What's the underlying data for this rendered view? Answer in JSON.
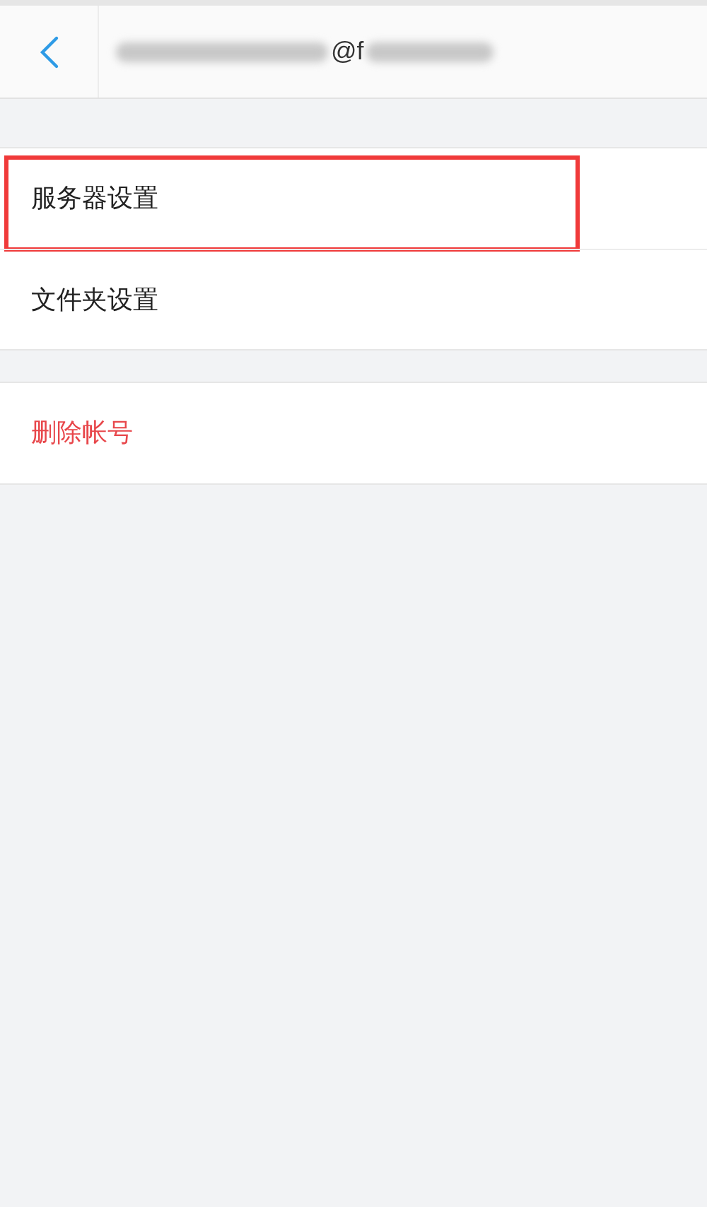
{
  "header": {
    "title": "@f"
  },
  "groups": [
    {
      "items": [
        {
          "label": "服务器设置",
          "kind": "normal",
          "highlighted": true
        },
        {
          "label": "文件夹设置",
          "kind": "normal",
          "highlighted": false
        }
      ]
    },
    {
      "items": [
        {
          "label": "删除帐号",
          "kind": "danger",
          "highlighted": false
        }
      ]
    }
  ]
}
